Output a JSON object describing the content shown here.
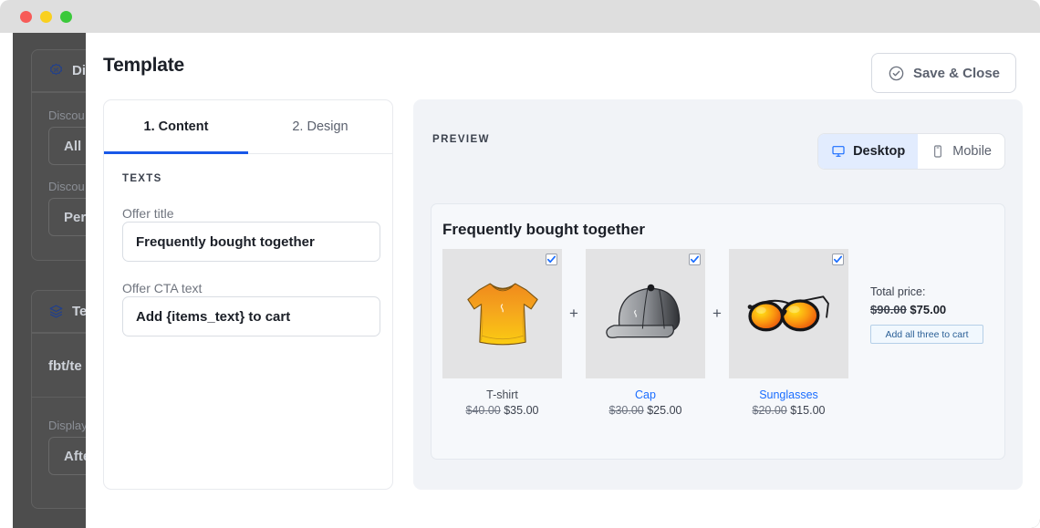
{
  "window": {
    "traffic_lights": [
      "close",
      "minimize",
      "maximize"
    ]
  },
  "background_app": {
    "sections": [
      {
        "icon": "discount-badge-icon",
        "title": "Di",
        "rows": [
          {
            "label": "Discou",
            "value": "All P"
          },
          {
            "label": "Discou",
            "value": "Perc"
          }
        ]
      },
      {
        "icon": "layers-icon",
        "title": "Te",
        "plain_value": "fbt/te",
        "rows": [
          {
            "label": "Display",
            "value": "Afte"
          }
        ]
      }
    ]
  },
  "modal": {
    "title": "Template",
    "save_close_label": "Save & Close",
    "save_close_icon": "check-circle-icon"
  },
  "content_panel": {
    "tabs": [
      {
        "label": "1. Content",
        "active": true
      },
      {
        "label": "2. Design",
        "active": false
      }
    ],
    "section_heading": "TEXTS",
    "fields": [
      {
        "label": "Offer title",
        "value": "Frequently bought together",
        "placeholder": "Offer title"
      },
      {
        "label": "Offer CTA text",
        "value": "Add {items_text} to cart",
        "placeholder": "Offer CTA text"
      }
    ]
  },
  "preview_panel": {
    "heading": "PREVIEW",
    "devices": [
      {
        "label": "Desktop",
        "icon": "monitor-icon",
        "active": true
      },
      {
        "label": "Mobile",
        "icon": "phone-icon",
        "active": false
      }
    ],
    "offer": {
      "title": "Frequently bought together",
      "separator": "+",
      "products": [
        {
          "name": "T-shirt",
          "is_link": false,
          "image": "tshirt-image",
          "old_price": "$40.00",
          "new_price": "$35.00",
          "checked": true
        },
        {
          "name": "Cap",
          "is_link": true,
          "image": "cap-image",
          "old_price": "$30.00",
          "new_price": "$25.00",
          "checked": true
        },
        {
          "name": "Sunglasses",
          "is_link": true,
          "image": "sunglasses-image",
          "old_price": "$20.00",
          "new_price": "$15.00",
          "checked": true
        }
      ],
      "total_label": "Total price:",
      "total_old_price": "$90.00",
      "total_new_price": "$75.00",
      "cta_label": "Add all three to cart"
    }
  },
  "colors": {
    "accent_blue": "#1858e8",
    "link_blue": "#1a6dff",
    "toggle_active_bg": "#e2ecfe",
    "panel_bg": "#f1f3f7",
    "border": "#e8eaee"
  }
}
